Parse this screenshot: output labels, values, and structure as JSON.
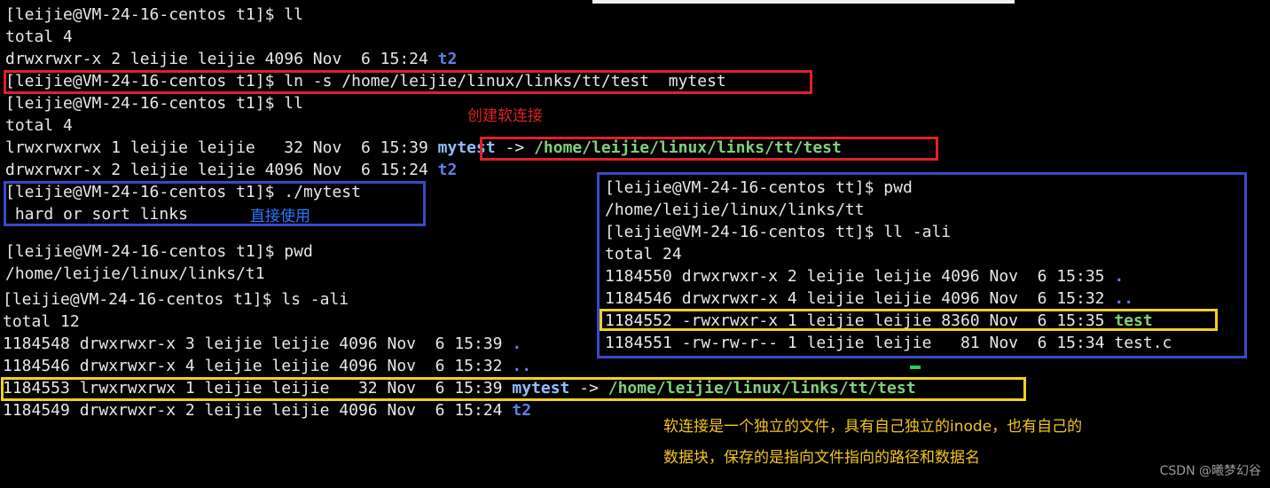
{
  "left_terminal": {
    "l1": "[leijie@VM-24-16-centos t1]$ ll",
    "l2": "total 4",
    "l3_prefix": "drwxrwxr-x 2 leijie leijie 4096 Nov  6 15:24 ",
    "l3_name": "t2",
    "l4": "[leijie@VM-24-16-centos t1]$ ln -s /home/leijie/linux/links/tt/test  mytest",
    "l5": "[leijie@VM-24-16-centos t1]$ ll",
    "l6": "total 4",
    "l7_prefix": "lrwxrwxrwx 1 leijie leijie   32 Nov  6 15:39 ",
    "l7_link": "mytest",
    "l7_arrow": " -> ",
    "l7_target": "/home/leijie/linux/links/tt/test",
    "l8_prefix": "drwxrwxr-x 2 leijie leijie 4096 Nov  6 15:24 ",
    "l8_name": "t2",
    "l9": "[leijie@VM-24-16-centos t1]$ ./mytest",
    "l10": " hard or sort links",
    "l11": "[leijie@VM-24-16-centos t1]$ pwd",
    "l12": "/home/leijie/linux/links/t1",
    "l13": "[leijie@VM-24-16-centos t1]$ ls -ali",
    "l14": "total 12",
    "l15_prefix": "1184548 drwxrwxr-x 3 leijie leijie 4096 Nov  6 15:39 ",
    "l15_name": ".",
    "l16_prefix": "1184546 drwxrwxr-x 4 leijie leijie 4096 Nov  6 15:32 ",
    "l16_name": "..",
    "l17_prefix": "1184553 lrwxrwxrwx 1 leijie leijie   32 Nov  6 15:39 ",
    "l17_link": "mytest",
    "l17_arrow": " -> ",
    "l17_target": "/home/leijie/linux/links/tt/test",
    "l18_prefix": "1184549 drwxrwxr-x 2 leijie leijie 4096 Nov  6 15:24 ",
    "l18_name": "t2"
  },
  "right_terminal": {
    "r1": "[leijie@VM-24-16-centos tt]$ pwd",
    "r2": "/home/leijie/linux/links/tt",
    "r3": "[leijie@VM-24-16-centos tt]$ ll -ali",
    "r4": "total 24",
    "r5_prefix": "1184550 drwxrwxr-x 2 leijie leijie 4096 Nov  6 15:35 ",
    "r5_name": ".",
    "r6_prefix": "1184546 drwxrwxr-x 4 leijie leijie 4096 Nov  6 15:32 ",
    "r6_name": "..",
    "r7_prefix": "1184552 -rwxrwxr-x 1 leijie leijie 8360 Nov  6 15:35 ",
    "r7_name": "test",
    "r8": "1184551 -rw-rw-r-- 1 leijie leijie   81 Nov  6 15:34 test.c"
  },
  "annotations": {
    "create_softlink": "创建软连接",
    "direct_use": "直接使用",
    "explain_line1": "软连接是一个独立的文件，具有自己独立的inode，也有自己的",
    "explain_line2": "数据块，保存的是指向文件指向的路径和数据名"
  },
  "watermark": "CSDN @曦梦幻谷",
  "colors": {
    "background": "#000000",
    "text": "#e8e8e8",
    "directory": "#5f7fe8",
    "symlink": "#8fc0ff",
    "executable": "#7fd07a",
    "red_box": "#e0202a",
    "blue_box": "#3a48c8",
    "yellow_box": "#f0d21e"
  }
}
